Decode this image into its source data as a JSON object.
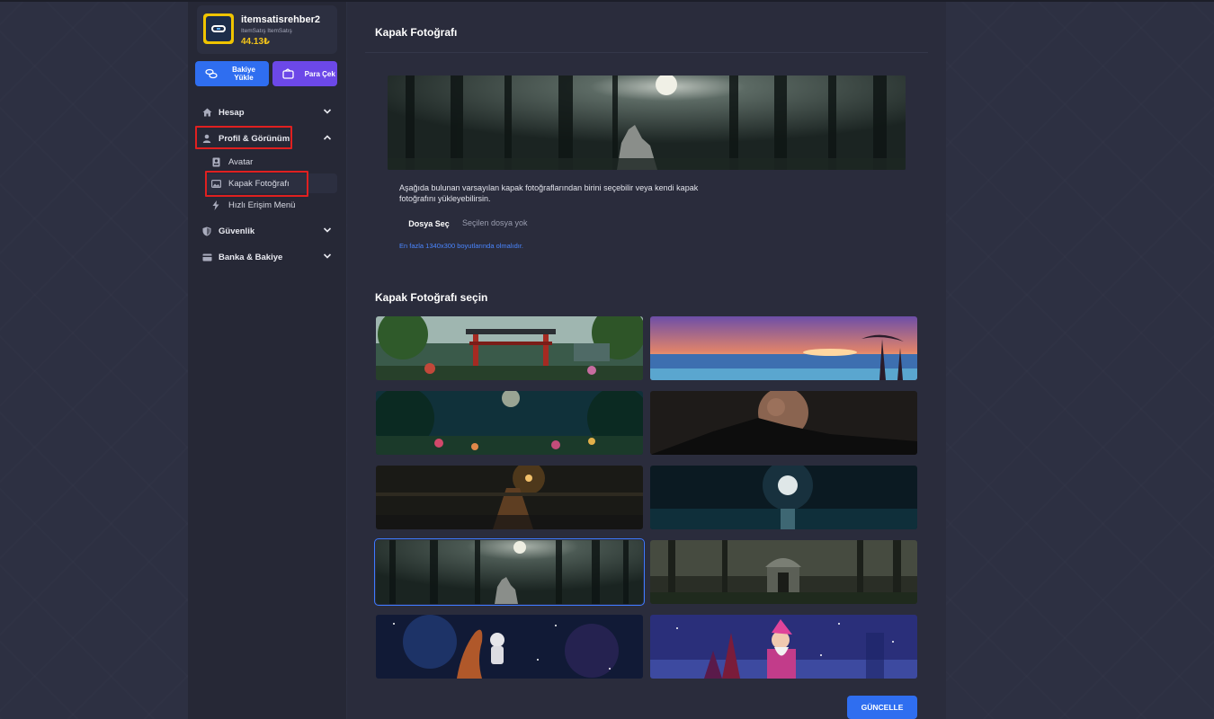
{
  "user": {
    "username": "itemsatisrehber2",
    "subtitle": "ItemSatış ItemSatış",
    "balance": "44.13₺"
  },
  "sidebar": {
    "load_balance": "Bakiye Yükle",
    "withdraw": "Para Çek",
    "items": [
      {
        "label": "Hesap",
        "icon": "home-icon",
        "expanded": false
      },
      {
        "label": "Profil & Görünüm",
        "icon": "user-icon",
        "expanded": true
      },
      {
        "label": "Güvenlik",
        "icon": "shield-icon",
        "expanded": false
      },
      {
        "label": "Banka & Bakiye",
        "icon": "card-icon",
        "expanded": false
      }
    ],
    "subitems": [
      {
        "label": "Avatar",
        "icon": "id-badge-icon"
      },
      {
        "label": "Kapak Fotoğrafı",
        "icon": "image-icon",
        "active": true
      },
      {
        "label": "Hızlı Erişim Menü",
        "icon": "bolt-icon"
      }
    ]
  },
  "main": {
    "title": "Kapak Fotoğrafı",
    "description": "Aşağıda bulunan varsayılan kapak fotoğraflarından birini seçebilir veya kendi kapak fotoğrafını yükleyebilirsin.",
    "file_button": "Dosya Seç",
    "file_status": "Seçilen dosya yok",
    "hint": "En fazla 1340x300 boyutlarında olmalıdır.",
    "choose_title": "Kapak Fotoğrafı seçin",
    "update_button": "GÜNCELLE",
    "selected_index": 6
  },
  "colors": {
    "accent": "#2f6ef0",
    "purple": "#6c48e8",
    "balance": "#f5c518",
    "highlight": "#e02020"
  }
}
